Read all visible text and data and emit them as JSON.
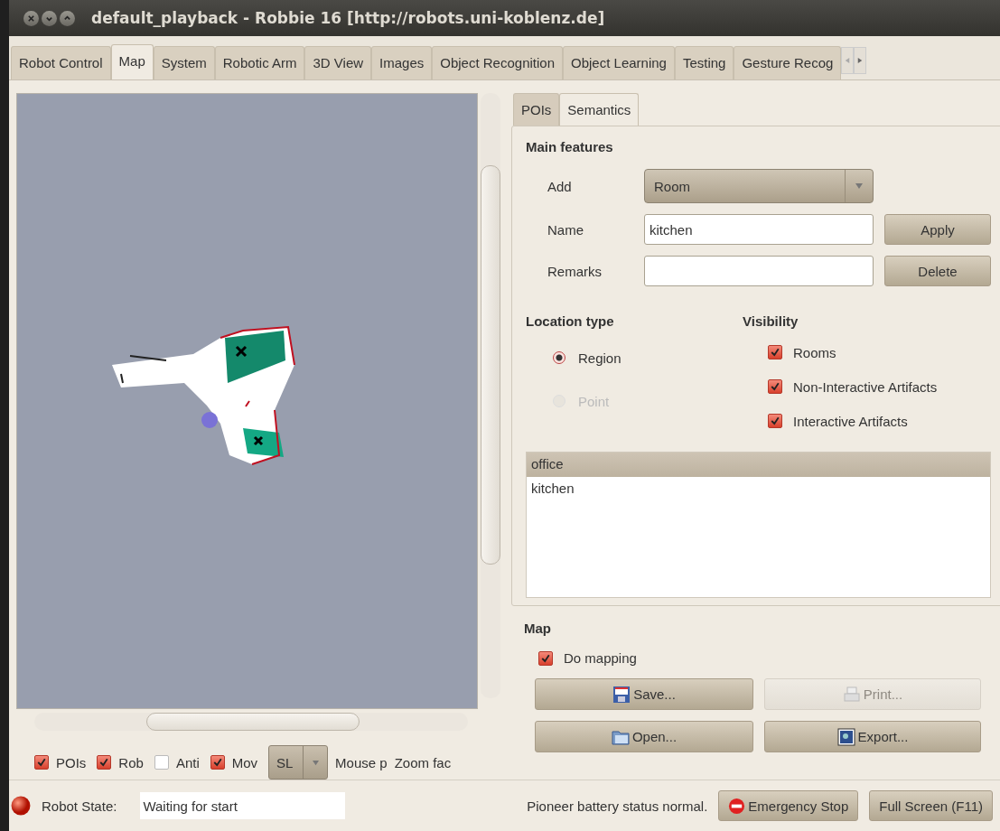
{
  "window": {
    "title": "default_playback - Robbie 16 [http://robots.uni-koblenz.de]"
  },
  "tabs": [
    {
      "label": "Robot Control",
      "selected": false
    },
    {
      "label": "Map",
      "selected": true
    },
    {
      "label": "System",
      "selected": false
    },
    {
      "label": "Robotic Arm",
      "selected": false
    },
    {
      "label": "3D View",
      "selected": false
    },
    {
      "label": "Images",
      "selected": false
    },
    {
      "label": "Object Recognition",
      "selected": false
    },
    {
      "label": "Object Learning",
      "selected": false
    },
    {
      "label": "Testing",
      "selected": false
    },
    {
      "label": "Gesture Recog",
      "selected": false
    }
  ],
  "map_options": {
    "checkboxes": [
      {
        "label": "POIs",
        "checked": true
      },
      {
        "label": "Rob",
        "checked": true
      },
      {
        "label": "Anti",
        "checked": false
      },
      {
        "label": "Mov",
        "checked": true
      }
    ],
    "mode_dropdown": {
      "value": "SL"
    },
    "mouse_label": "Mouse p",
    "zoom_label": "Zoom fac"
  },
  "side_tabs": [
    {
      "label": "POIs",
      "selected": false
    },
    {
      "label": "Semantics",
      "selected": true
    }
  ],
  "main_features": {
    "title": "Main features",
    "add_label": "Add",
    "add_value": "Room",
    "name_label": "Name",
    "name_value": "kitchen",
    "remarks_label": "Remarks",
    "apply_button": "Apply",
    "delete_button": "Delete"
  },
  "location_type": {
    "title": "Location type",
    "options": [
      {
        "label": "Region",
        "selected": true,
        "disabled": false
      },
      {
        "label": "Point",
        "selected": false,
        "disabled": true
      }
    ]
  },
  "visibility": {
    "title": "Visibility",
    "items": [
      {
        "label": "Rooms",
        "checked": true
      },
      {
        "label": "Non-Interactive Artifacts",
        "checked": true
      },
      {
        "label": "Interactive Artifacts",
        "checked": true
      }
    ]
  },
  "feature_list": [
    {
      "label": "office",
      "selected": true
    },
    {
      "label": "kitchen",
      "selected": false
    }
  ],
  "map_section": {
    "title": "Map",
    "do_mapping": {
      "label": "Do mapping",
      "checked": true
    },
    "buttons": [
      {
        "label": "Save...",
        "kind": "save",
        "disabled": false
      },
      {
        "label": "Print...",
        "kind": "print",
        "disabled": true
      },
      {
        "label": "Open...",
        "kind": "open",
        "disabled": false
      },
      {
        "label": "Export...",
        "kind": "export",
        "disabled": false
      }
    ]
  },
  "status_bar": {
    "state_label": "Robot State:",
    "state_value": "Waiting for start",
    "battery_message": "Pioneer battery status normal.",
    "emergency_button": "Emergency Stop",
    "fullscreen_button": "Full Screen (F11)"
  }
}
